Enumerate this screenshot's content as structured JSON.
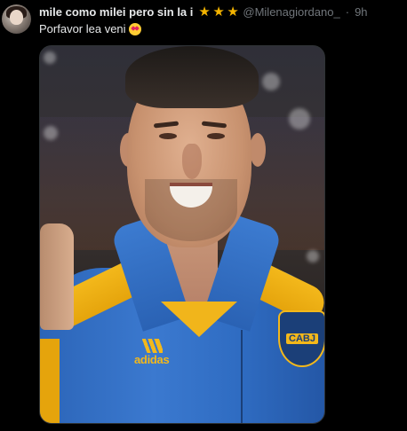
{
  "tweet": {
    "display_name": "mile como milei pero sin la i",
    "name_emojis": [
      "star",
      "star",
      "star"
    ],
    "handle": "@Milenagiordano_",
    "separator": "·",
    "time": "9h",
    "text": "Porfavor lea veni",
    "text_emoji": "smiling-face-with-heart-eyes"
  },
  "media": {
    "brand_label": "adidas",
    "badge_label": "CABJ"
  },
  "colors": {
    "background": "#000000",
    "primary_text": "#e7e9ea",
    "secondary_text": "#71767b",
    "star": "#f4b400",
    "jacket_blue": "#2f6cc2",
    "jacket_yellow": "#f3b81b"
  }
}
